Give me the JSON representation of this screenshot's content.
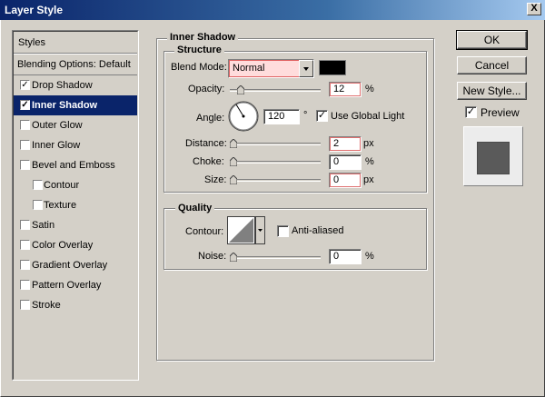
{
  "window": {
    "title": "Layer Style",
    "close_glyph": "X"
  },
  "styles_panel": {
    "header": "Styles",
    "blending": "Blending Options: Default",
    "items": [
      {
        "label": "Drop Shadow",
        "checked": true,
        "selected": false,
        "sub": false
      },
      {
        "label": "Inner Shadow",
        "checked": true,
        "selected": true,
        "sub": false
      },
      {
        "label": "Outer Glow",
        "checked": false,
        "selected": false,
        "sub": false
      },
      {
        "label": "Inner Glow",
        "checked": false,
        "selected": false,
        "sub": false
      },
      {
        "label": "Bevel and Emboss",
        "checked": false,
        "selected": false,
        "sub": false
      },
      {
        "label": "Contour",
        "checked": false,
        "selected": false,
        "sub": true
      },
      {
        "label": "Texture",
        "checked": false,
        "selected": false,
        "sub": true
      },
      {
        "label": "Satin",
        "checked": false,
        "selected": false,
        "sub": false
      },
      {
        "label": "Color Overlay",
        "checked": false,
        "selected": false,
        "sub": false
      },
      {
        "label": "Gradient Overlay",
        "checked": false,
        "selected": false,
        "sub": false
      },
      {
        "label": "Pattern Overlay",
        "checked": false,
        "selected": false,
        "sub": false
      },
      {
        "label": "Stroke",
        "checked": false,
        "selected": false,
        "sub": false
      }
    ]
  },
  "inner_shadow": {
    "title": "Inner Shadow",
    "structure": {
      "title": "Structure",
      "blend_mode_label": "Blend Mode:",
      "blend_mode_value": "Normal",
      "shadow_color": "#000000",
      "opacity_label": "Opacity:",
      "opacity_value": "12",
      "opacity_unit": "%",
      "angle_label": "Angle:",
      "angle_value": "120",
      "angle_unit": "°",
      "global_light_label": "Use Global Light",
      "global_light_checked": true,
      "distance_label": "Distance:",
      "distance_value": "2",
      "distance_unit": "px",
      "choke_label": "Choke:",
      "choke_value": "0",
      "choke_unit": "%",
      "size_label": "Size:",
      "size_value": "0",
      "size_unit": "px"
    },
    "quality": {
      "title": "Quality",
      "contour_label": "Contour:",
      "anti_aliased_label": "Anti-aliased",
      "anti_aliased_checked": false,
      "noise_label": "Noise:",
      "noise_value": "0",
      "noise_unit": "%"
    }
  },
  "buttons": {
    "ok": "OK",
    "cancel": "Cancel",
    "new_style": "New Style..."
  },
  "preview": {
    "label": "Preview",
    "checked": true
  }
}
